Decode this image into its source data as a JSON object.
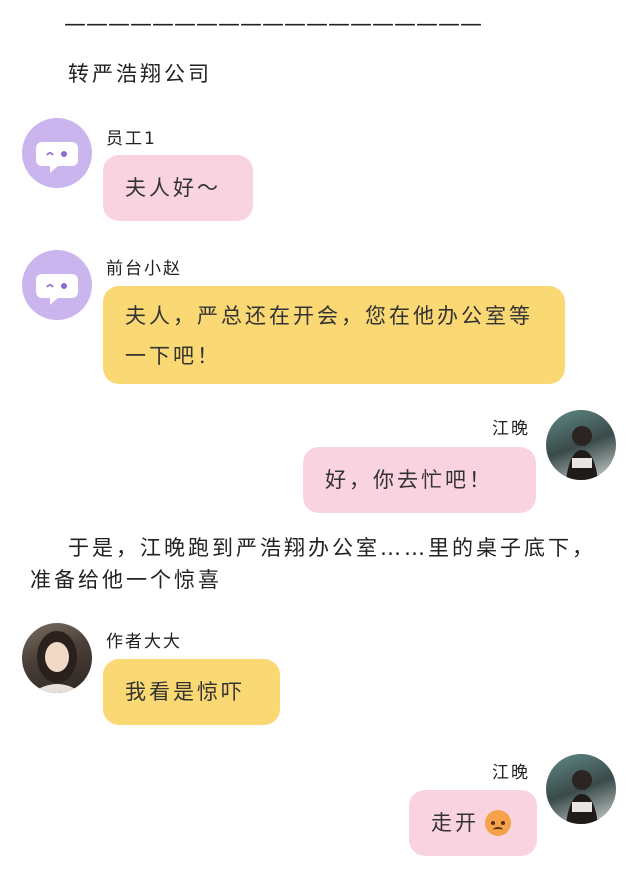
{
  "divider": "———————————————————",
  "heading": "转严浩翔公司",
  "messages": [
    {
      "sender": "员工1",
      "text": "夫人好～"
    },
    {
      "sender": "前台小赵",
      "text": "夫人，严总还在开会，您在他办公室等一下吧！"
    },
    {
      "sender": "江晚",
      "text": "好，你去忙吧！"
    },
    {
      "sender": "作者大大",
      "text": "我看是惊吓"
    },
    {
      "sender": "江晚",
      "text": "走开",
      "emoji": "angry-face-icon"
    }
  ],
  "narration": "于是，江晚跑到严浩翔办公室……里的桌子底下，准备给他一个惊喜",
  "colors": {
    "pink_bubble": "#fad3e0",
    "yellow_bubble": "#fad873",
    "avatar_purple": "#cbb5ee"
  }
}
